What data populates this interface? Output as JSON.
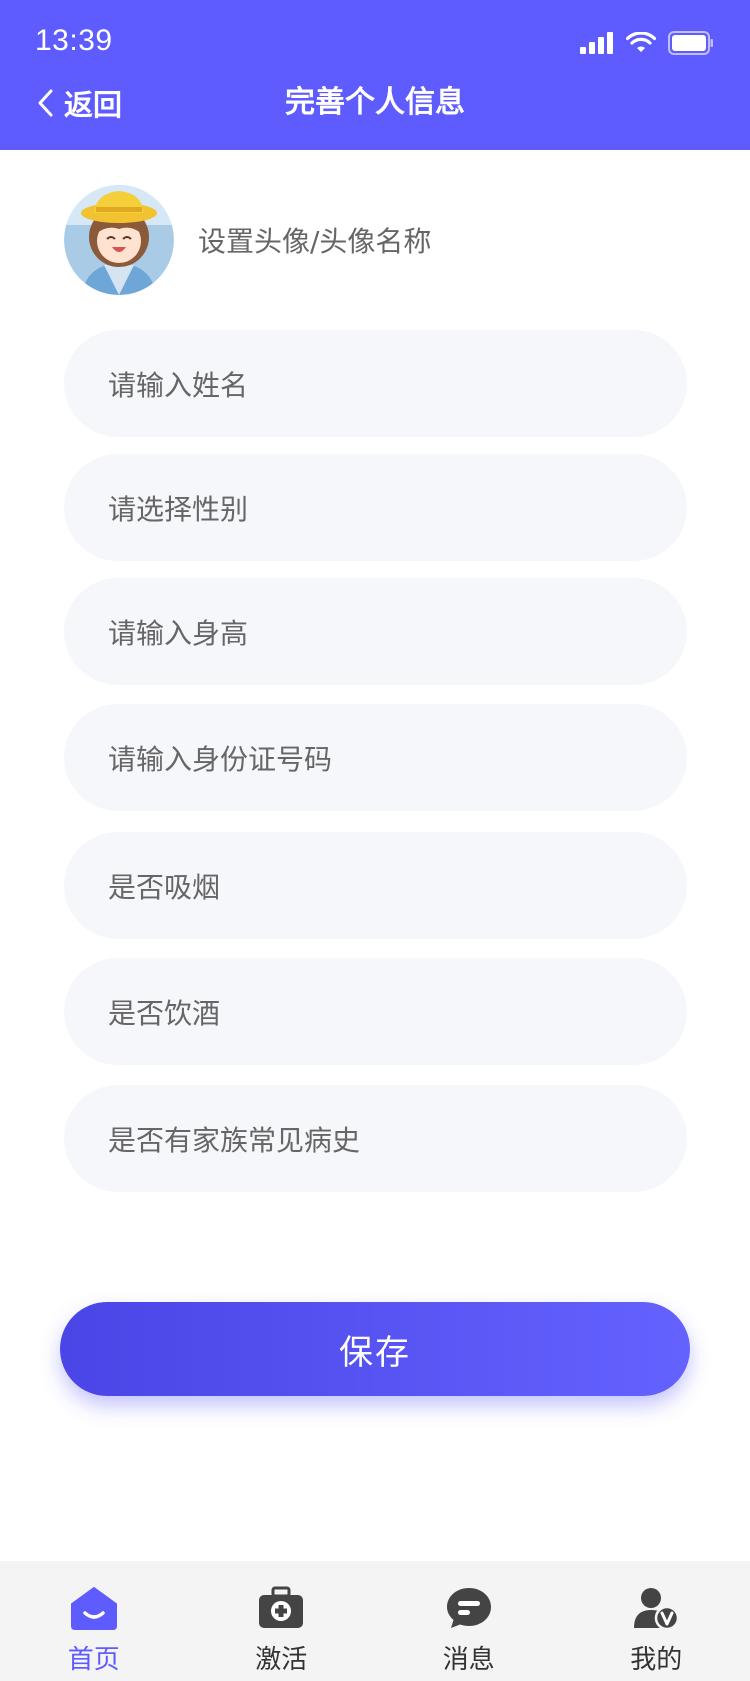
{
  "status_bar": {
    "time": "13:39"
  },
  "header": {
    "back_label": "返回",
    "title": "完善个人信息"
  },
  "avatar": {
    "label": "设置头像/头像名称"
  },
  "fields": [
    {
      "placeholder": "请输入姓名"
    },
    {
      "placeholder": "请选择性别"
    },
    {
      "placeholder": "请输入身高"
    },
    {
      "placeholder": "请输入身份证号码"
    },
    {
      "placeholder": "是否吸烟"
    },
    {
      "placeholder": "是否饮酒"
    },
    {
      "placeholder": "是否有家族常见病史"
    }
  ],
  "save_button": {
    "label": "保存"
  },
  "tabbar": {
    "items": [
      {
        "label": "首页",
        "icon": "home-icon",
        "active": true
      },
      {
        "label": "激活",
        "icon": "medical-kit-icon",
        "active": false
      },
      {
        "label": "消息",
        "icon": "message-icon",
        "active": false
      },
      {
        "label": "我的",
        "icon": "user-icon",
        "active": false
      }
    ]
  },
  "colors": {
    "primary": "#5f5cff",
    "field_bg": "#f6f7fb",
    "placeholder_text": "#666666",
    "tab_inactive_icon": "#444444"
  }
}
